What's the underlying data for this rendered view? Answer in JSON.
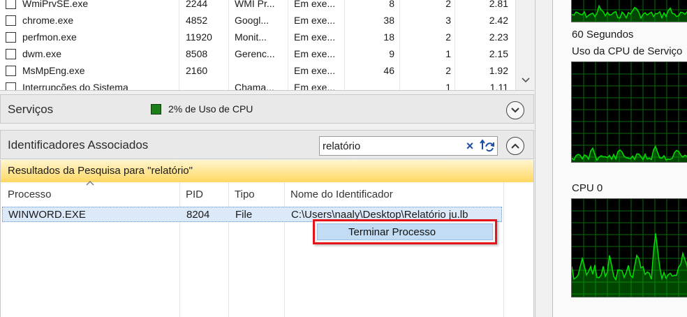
{
  "processes": {
    "rows": [
      {
        "name": "WmiPrvSE.exe",
        "pid": "2244",
        "desc": "WMI Pr...",
        "status": "Em exe...",
        "threads": "8",
        "cpu": "2",
        "avg": "2.81"
      },
      {
        "name": "chrome.exe",
        "pid": "4852",
        "desc": "Googl...",
        "status": "Em exe...",
        "threads": "38",
        "cpu": "3",
        "avg": "2.42"
      },
      {
        "name": "perfmon.exe",
        "pid": "11920",
        "desc": "Monit...",
        "status": "Em exe...",
        "threads": "18",
        "cpu": "2",
        "avg": "2.23"
      },
      {
        "name": "dwm.exe",
        "pid": "8508",
        "desc": "Gerenc...",
        "status": "Em exe...",
        "threads": "9",
        "cpu": "1",
        "avg": "2.15"
      },
      {
        "name": "MsMpEng.exe",
        "pid": "2160",
        "desc": "",
        "status": "Em exe...",
        "threads": "46",
        "cpu": "2",
        "avg": "1.92"
      },
      {
        "name": "Interrupções do Sistema",
        "pid": "",
        "desc": "Chama...",
        "status": "Em exe...",
        "threads": "",
        "cpu": "1",
        "avg": "1.11"
      }
    ]
  },
  "services": {
    "title": "Serviços",
    "cpu_text": "2% de Uso de CPU",
    "indicator_color": "#1a7f1a"
  },
  "handles": {
    "title": "Identificadores Associados",
    "search_value": "relatório",
    "clear_icon": "×",
    "results_text": "Resultados da Pesquisa para \"relatório\"",
    "columns": {
      "process": "Processo",
      "pid": "PID",
      "type": "Tipo",
      "handle_name": "Nome do Identificador"
    },
    "row": {
      "process": "WINWORD.EXE",
      "pid": "8204",
      "type": "File",
      "handle_name": "C:\\Users\\naaly\\Desktop\\Relatório ju.lb"
    }
  },
  "context_menu": {
    "item_label": "Terminar Processo",
    "highlight_color": "#e5141a"
  },
  "graphs": {
    "top_label": "60 Segundos",
    "service_cpu_label": "Uso da CPU de Serviço",
    "cpu0_label": "CPU 0",
    "line_color": "#00e000",
    "grid_color": "#0a6b0a"
  }
}
